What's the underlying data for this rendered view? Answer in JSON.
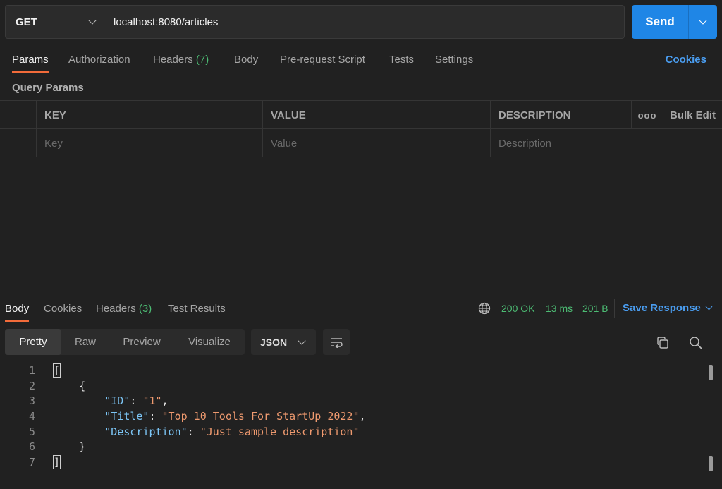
{
  "request": {
    "method": "GET",
    "url": "localhost:8080/articles",
    "send_label": "Send"
  },
  "request_tabs": [
    {
      "label": "Params"
    },
    {
      "label": "Authorization"
    },
    {
      "label": "Headers",
      "count": "(7)"
    },
    {
      "label": "Body"
    },
    {
      "label": "Pre-request Script"
    },
    {
      "label": "Tests"
    },
    {
      "label": "Settings"
    }
  ],
  "cookies_label": "Cookies",
  "query_params": {
    "title": "Query Params",
    "columns": [
      "KEY",
      "VALUE",
      "DESCRIPTION"
    ],
    "bulk_edit": "Bulk Edit",
    "placeholders": {
      "key": "Key",
      "value": "Value",
      "description": "Description"
    }
  },
  "response": {
    "tabs": [
      {
        "label": "Body"
      },
      {
        "label": "Cookies"
      },
      {
        "label": "Headers",
        "count": "(3)"
      },
      {
        "label": "Test Results"
      }
    ],
    "status": "200 OK",
    "time": "13 ms",
    "size": "201 B",
    "save_label": "Save Response",
    "view_tabs": [
      "Pretty",
      "Raw",
      "Preview",
      "Visualize"
    ],
    "format": "JSON",
    "body_lines": [
      {
        "n": "1"
      },
      {
        "n": "2"
      },
      {
        "n": "3",
        "key": "\"ID\"",
        "value": "\"1\""
      },
      {
        "n": "4",
        "key": "\"Title\"",
        "value": "\"Top 10 Tools For StartUp 2022\""
      },
      {
        "n": "5",
        "key": "\"Description\"",
        "value": "\"Just sample description\""
      },
      {
        "n": "6"
      },
      {
        "n": "7"
      }
    ]
  },
  "colors": {
    "accent": "#f26b3a",
    "send": "#1f86e6",
    "link": "#4a9df0",
    "success": "#4cbb73"
  }
}
